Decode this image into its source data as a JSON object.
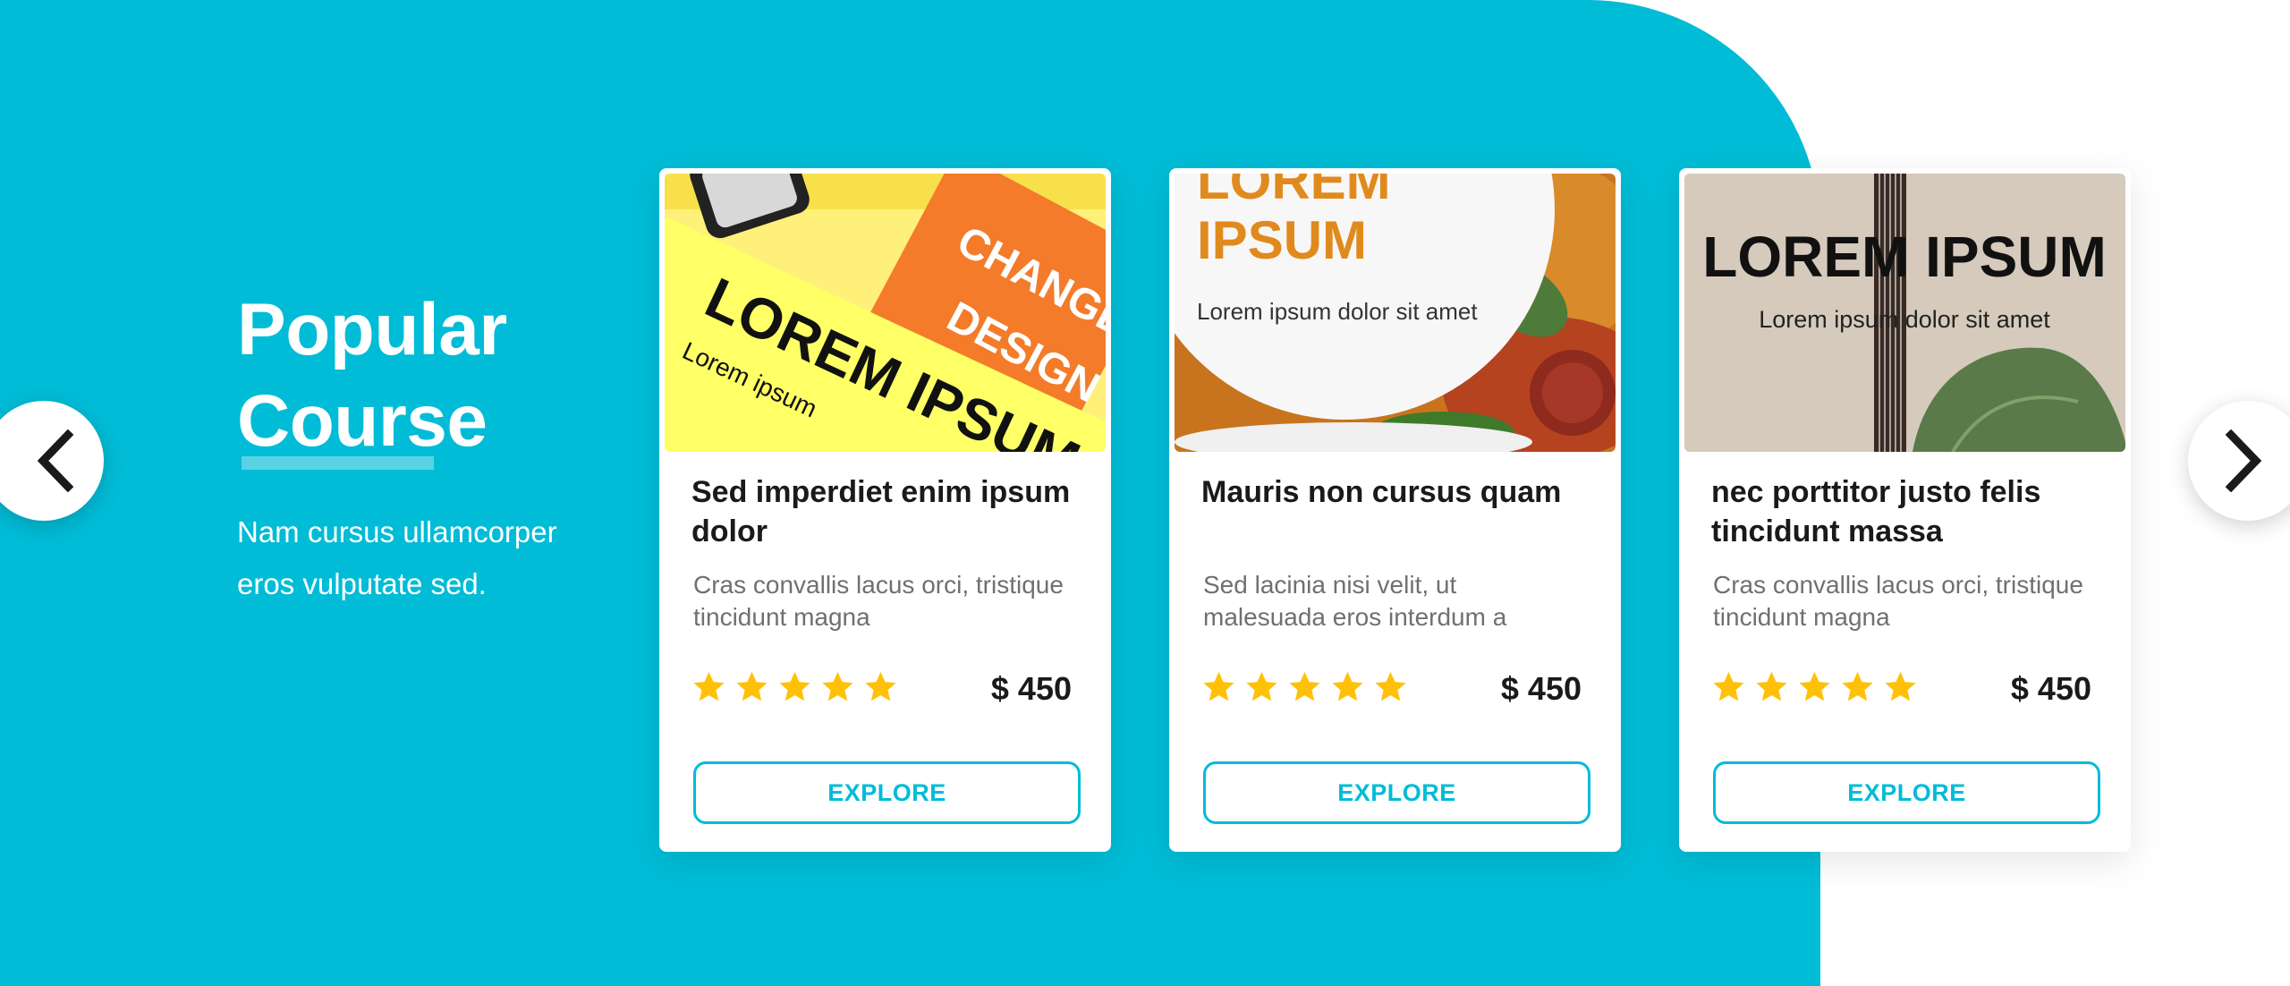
{
  "intro": {
    "title_line1": "Popular",
    "title_line2": "Course",
    "subtitle_line1": "Nam cursus ullamcorper",
    "subtitle_line2": "eros vulputate sed."
  },
  "navigation": {
    "prev_icon": "chevron-left-icon",
    "next_icon": "chevron-right-icon"
  },
  "colors": {
    "accent": "#00BCD6",
    "star": "#FFC107",
    "text_dark": "#1a1a1a",
    "text_muted": "#707070"
  },
  "courses": [
    {
      "image": {
        "big": "LOREM IPSUM",
        "small": "Lorem ipsum",
        "book_text1": "CHANGE",
        "book_text2": "DESIGN"
      },
      "title": "Sed imperdiet enim ipsum dolor",
      "description": "Cras convallis lacus orci, tristique tincidunt magna",
      "rating": 5,
      "price": "$ 450",
      "button": "EXPLORE"
    },
    {
      "image": {
        "big1": "LOREM",
        "big2": "IPSUM",
        "small": "Lorem ipsum dolor sit amet"
      },
      "title": "Mauris non cursus quam",
      "description": "Sed lacinia nisi velit, ut malesuada eros interdum a",
      "rating": 5,
      "price": "$ 450",
      "button": "EXPLORE"
    },
    {
      "image": {
        "big": "LOREM IPSUM",
        "small": "Lorem ipsum dolor sit amet"
      },
      "title": "nec porttitor justo felis tincidunt massa",
      "description": "Cras convallis lacus orci, tristique tincidunt magna",
      "rating": 5,
      "price": "$ 450",
      "button": "EXPLORE"
    }
  ]
}
